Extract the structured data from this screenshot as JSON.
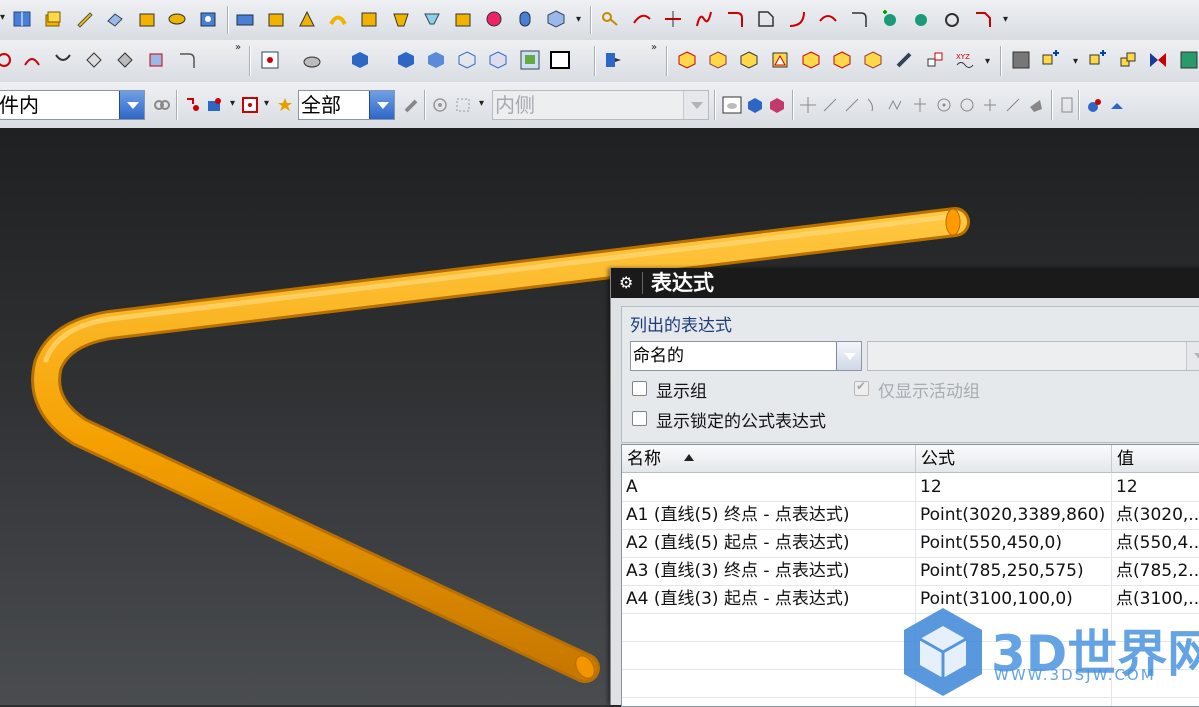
{
  "toolbar3": {
    "combo1_value": "件内",
    "combo2_value": "全部",
    "combo3_value": "内侧"
  },
  "dialog": {
    "title": "表达式",
    "group_label": "列出的表达式",
    "list_combo_value": "命名的",
    "show_group_label": "显示组",
    "only_active_label": "仅显示活动组",
    "show_locked_label": "显示锁定的公式表达式",
    "columns": {
      "name": "名称",
      "formula": "公式",
      "value": "值"
    },
    "rows": [
      {
        "name": "A",
        "formula": "12",
        "value": "12"
      },
      {
        "name": "A1  (直线(5) 终点 - 点表达式)",
        "formula": "Point(3020,3389,860)",
        "value": "点(3020,..."
      },
      {
        "name": "A2  (直线(5) 起点 - 点表达式)",
        "formula": "Point(550,450,0)",
        "value": "点(550,4..."
      },
      {
        "name": "A3  (直线(3) 终点 - 点表达式)",
        "formula": "Point(785,250,575)",
        "value": "点(785,2..."
      },
      {
        "name": "A4  (直线(3) 起点 - 点表达式)",
        "formula": "Point(3100,100,0)",
        "value": "点(3100,..."
      }
    ]
  },
  "watermark": {
    "text": "3D世界网",
    "url": "WWW.3DSJW.COM"
  },
  "colors": {
    "tube": "#f5a000",
    "accent_blue": "#2e66c6",
    "dialog_title_bg": "#1a1a1a"
  }
}
